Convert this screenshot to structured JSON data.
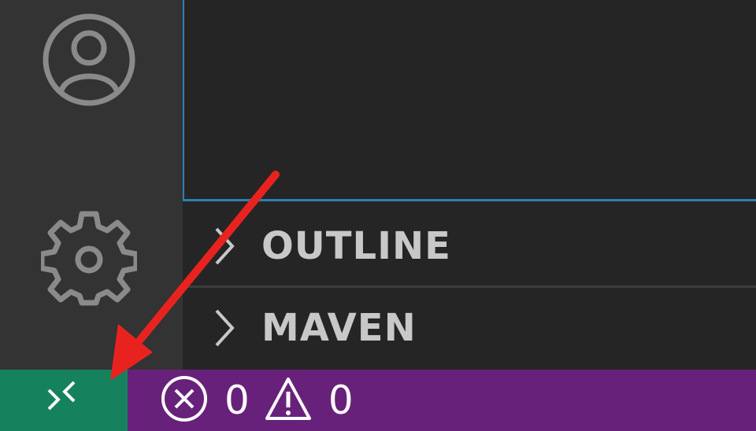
{
  "activity_bar": {
    "icons": [
      {
        "name": "account-icon"
      },
      {
        "name": "gear-icon"
      }
    ]
  },
  "sidebar": {
    "sections": [
      {
        "label": "OUTLINE",
        "expanded": false
      },
      {
        "label": "MAVEN",
        "expanded": false
      }
    ]
  },
  "statusbar": {
    "remote_icon": "remote-indicator-icon",
    "errors": "0",
    "warnings": "0"
  },
  "colors": {
    "statusbar": "#68217a",
    "remote_indicator": "#16825d",
    "activity_bar": "#333333",
    "sidebar": "#252526",
    "focus_border": "#2f7fb3",
    "annotation_arrow": "#e8231f"
  }
}
